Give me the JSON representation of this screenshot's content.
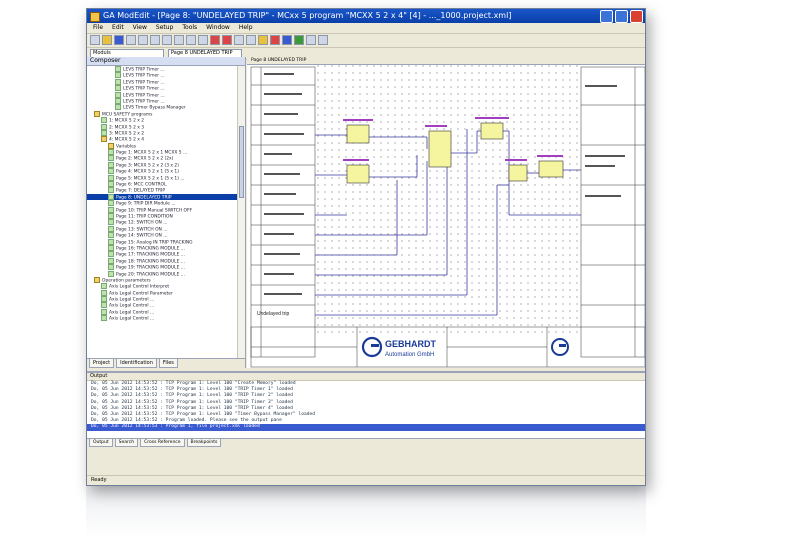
{
  "window": {
    "title": "GA ModEdit - [Page 8: \"UNDELAYED TRIP\" - MCxx 5 program \"MCXX 5 2 x 4\" [4] - ..._1000.project.xml]",
    "menu": [
      "File",
      "Edit",
      "View",
      "Setup",
      "Tools",
      "Window",
      "Help"
    ],
    "toolbar_field": "Moduls",
    "toolbar_field2": "Page 8 UNDELAYED TRIP"
  },
  "left_panel": {
    "header": "Composer",
    "tree": [
      {
        "label": "LEVS TRIP Timer ...",
        "indent": 4,
        "icon": "leaf"
      },
      {
        "label": "LEVS TRIP Timer ...",
        "indent": 4,
        "icon": "leaf"
      },
      {
        "label": "LEVS TRIP Timer ...",
        "indent": 4,
        "icon": "leaf"
      },
      {
        "label": "LEVS TRIP Timer ...",
        "indent": 4,
        "icon": "leaf"
      },
      {
        "label": "LEVS TRIP Timer ...",
        "indent": 4,
        "icon": "leaf"
      },
      {
        "label": "LEVS TRIP Timer ...",
        "indent": 4,
        "icon": "leaf"
      },
      {
        "label": "LEVS Timer Bypass Manager",
        "indent": 4,
        "icon": "leaf"
      },
      {
        "label": "MCU SAFETY programs",
        "indent": 1,
        "icon": "folder"
      },
      {
        "label": "1: MCXX 5 2 x 2",
        "indent": 2,
        "icon": "leaf"
      },
      {
        "label": "2: MCXX 5 2 x 3",
        "indent": 2,
        "icon": "leaf"
      },
      {
        "label": "3: MCXX 5 2 x 2",
        "indent": 2,
        "icon": "leaf"
      },
      {
        "label": "4: MCXX 5 2 x 4",
        "indent": 2,
        "icon": "folder"
      },
      {
        "label": "Variables",
        "indent": 3,
        "icon": "folder"
      },
      {
        "label": "Page 1: MCXX 5 2 x 1 MCXX 5 ...",
        "indent": 3,
        "icon": "leaf"
      },
      {
        "label": "Page 2: MCXX 5 2 x 2 (2x)",
        "indent": 3,
        "icon": "leaf"
      },
      {
        "label": "Page 3: MCXX 5 2 x 2 (3 x 2)",
        "indent": 3,
        "icon": "leaf"
      },
      {
        "label": "Page 4: MCXX 5 2 x 1 (5 x 1)",
        "indent": 3,
        "icon": "leaf"
      },
      {
        "label": "Page 5: MCXX 5 2 x 1 (5 x 1) ...",
        "indent": 3,
        "icon": "leaf"
      },
      {
        "label": "Page 6: MCC CONTROL",
        "indent": 3,
        "icon": "leaf"
      },
      {
        "label": "Page 7: DELAYED TRIP",
        "indent": 3,
        "icon": "leaf"
      },
      {
        "label": "Page 8: UNDELAYED TRIP",
        "indent": 3,
        "icon": "leaf",
        "selected": true
      },
      {
        "label": "Page 9: TRIP DIR Module ...",
        "indent": 3,
        "icon": "leaf"
      },
      {
        "label": "Page 10: TRIP Manual SWITCH OFF",
        "indent": 3,
        "icon": "leaf"
      },
      {
        "label": "Page 11: TRIP CONDITION",
        "indent": 3,
        "icon": "leaf"
      },
      {
        "label": "Page 12: SWITCH ON ...",
        "indent": 3,
        "icon": "leaf"
      },
      {
        "label": "Page 13: SWITCH ON ...",
        "indent": 3,
        "icon": "leaf"
      },
      {
        "label": "Page 14: SWITCH ON ...",
        "indent": 3,
        "icon": "leaf"
      },
      {
        "label": "Page 15: Analog IN TRIP TRACKING",
        "indent": 3,
        "icon": "leaf"
      },
      {
        "label": "Page 16: TRACKING MODULE ...",
        "indent": 3,
        "icon": "leaf"
      },
      {
        "label": "Page 17: TRACKING MODULE ...",
        "indent": 3,
        "icon": "leaf"
      },
      {
        "label": "Page 18: TRACKING MODULE ...",
        "indent": 3,
        "icon": "leaf"
      },
      {
        "label": "Page 19: TRACKING MODULE ...",
        "indent": 3,
        "icon": "leaf"
      },
      {
        "label": "Page 20: TRACKING MODULE ...",
        "indent": 3,
        "icon": "leaf"
      },
      {
        "label": "Operation parameters",
        "indent": 1,
        "icon": "folder"
      },
      {
        "label": "Axis Legal Control Interpret",
        "indent": 2,
        "icon": "leaf"
      },
      {
        "label": "Axis Legal Control Parameter",
        "indent": 2,
        "icon": "leaf"
      },
      {
        "label": "Axis Legal Control ...",
        "indent": 2,
        "icon": "leaf"
      },
      {
        "label": "Axis Legal Control ...",
        "indent": 2,
        "icon": "leaf"
      },
      {
        "label": "Axis Legal Control ...",
        "indent": 2,
        "icon": "leaf"
      },
      {
        "label": "Axis Legal Control ...",
        "indent": 2,
        "icon": "leaf"
      }
    ],
    "tabs": [
      "Project",
      "Identification",
      "Files"
    ]
  },
  "document": {
    "tab": "Page 8 UNDELAYED TRIP",
    "company_line1": "GEBHARDT",
    "company_line2": "Automation GmbH",
    "sheet_note": "Undelayed trip"
  },
  "output": {
    "header": "Output",
    "lines": [
      "Do, 05 Jun 2012 14:53:52 : TCP Program 1: Level 100 \"Create Memory\" loaded",
      "Do, 05 Jun 2012 14:53:52 : TCP Program 1: Level 100 \"TRIP Timer 1\" loaded",
      "Do, 05 Jun 2012 14:53:52 : TCP Program 1: Level 100 \"TRIP Timer 2\" loaded",
      "Do, 05 Jun 2012 14:53:52 : TCP Program 1: Level 100 \"TRIP Timer 3\" loaded",
      "Do, 05 Jun 2012 14:53:52 : TCP Program 1: Level 100 \"TRIP Timer 4\" loaded",
      "Do, 05 Jun 2012 14:53:52 : TCP Program 1: Level 100 \"Timer Bypass Manager\" loaded",
      "Do, 05 Jun 2012 14:53:52 : Program loaded. Please see the output pane",
      "Do, 05 Jun 2012 14:53:53 : Program 1, file project.xml loaded"
    ],
    "highlight_index": 7,
    "tabs": [
      "Output",
      "Search",
      "Cross Reference",
      "Breakpoints"
    ]
  },
  "status": "Ready"
}
